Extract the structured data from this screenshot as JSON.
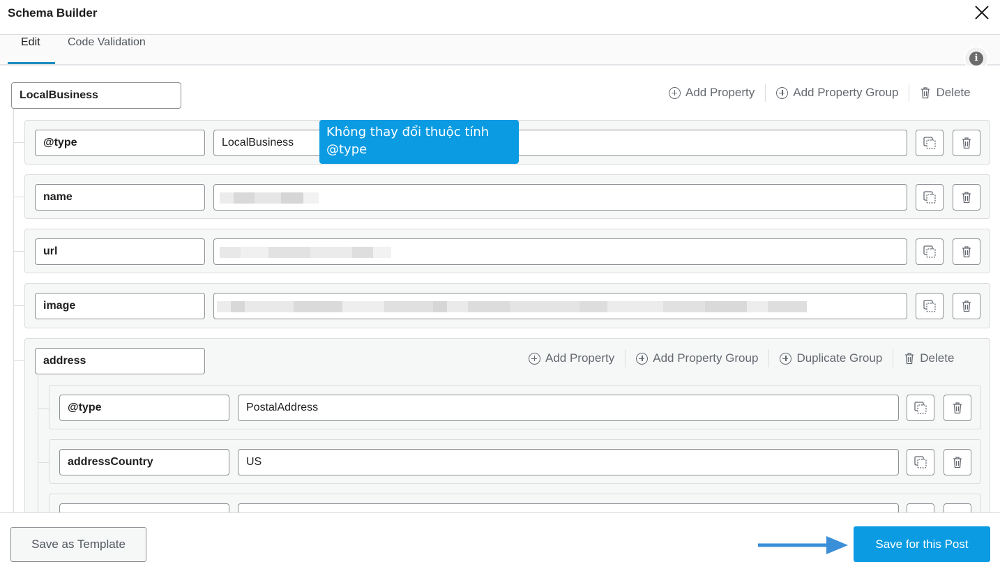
{
  "window": {
    "title": "Schema Builder"
  },
  "tabs": [
    {
      "label": "Edit",
      "active": true
    },
    {
      "label": "Code Validation",
      "active": false
    }
  ],
  "root": {
    "key": "LocalBusiness",
    "actions": {
      "add_property": "Add Property",
      "add_property_group": "Add Property Group",
      "delete": "Delete"
    }
  },
  "properties": [
    {
      "key": "@type",
      "value": "LocalBusiness",
      "value_obscured": false
    },
    {
      "key": "name",
      "value": "",
      "value_obscured": true
    },
    {
      "key": "url",
      "value": "",
      "value_obscured": true
    },
    {
      "key": "image",
      "value": "",
      "value_obscured": true
    }
  ],
  "group": {
    "key": "address",
    "actions": {
      "add_property": "Add Property",
      "add_property_group": "Add Property Group",
      "duplicate_group": "Duplicate Group",
      "delete": "Delete"
    },
    "properties": [
      {
        "key": "@type",
        "value": "PostalAddress"
      },
      {
        "key": "addressCountry",
        "value": "US"
      },
      {
        "key": "",
        "value": ""
      }
    ]
  },
  "tooltip": {
    "text_line1": "Không thay đổi thuộc tính",
    "text_line2": "@type"
  },
  "footer": {
    "save_template_label": "Save as Template",
    "save_post_label": "Save for this Post"
  },
  "icons": {
    "close": "close-icon",
    "info": "info-icon",
    "plus": "plus-circle-icon",
    "trash": "trash-icon",
    "duplicate": "duplicate-icon",
    "arrow": "arrow-right-icon"
  },
  "colors": {
    "accent": "#0a9be2",
    "tab_underline": "#1e8cbe",
    "border": "#8c8f94",
    "row_bg": "#f6f7f7"
  }
}
